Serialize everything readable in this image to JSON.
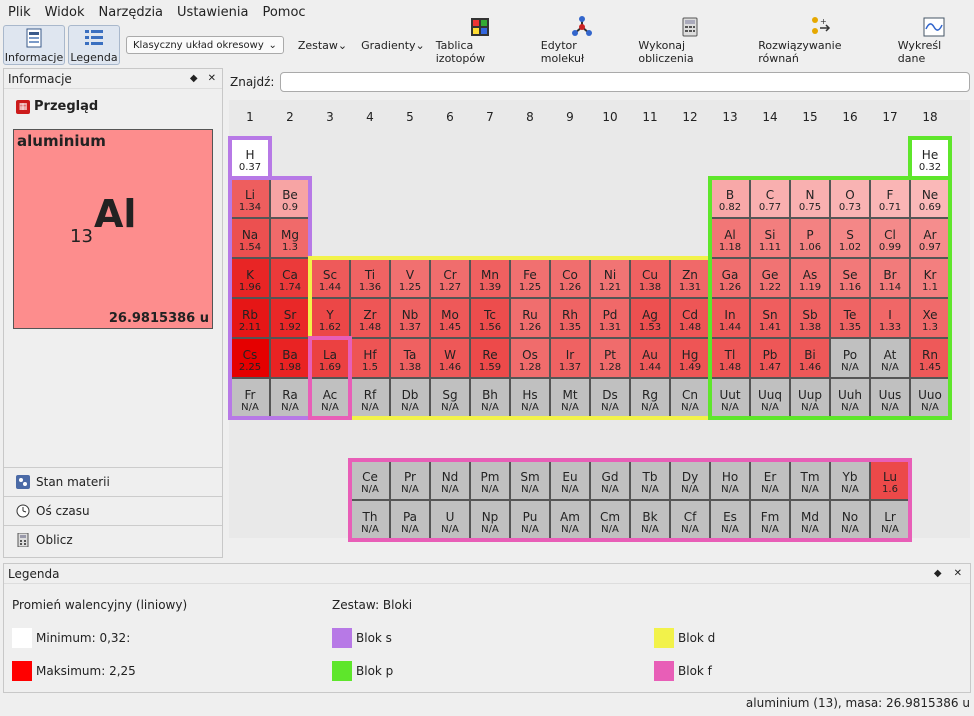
{
  "menu": [
    "Plik",
    "Widok",
    "Narzędzia",
    "Ustawienia",
    "Pomoc"
  ],
  "toolbar": {
    "info": "Informacje",
    "legend": "Legenda",
    "layout": "Klasyczny układ okresowy",
    "sets": "Zestaw",
    "gradients": "Gradienty",
    "isotopes": "Tablica izotopów",
    "molecule": "Edytor molekuł",
    "calc": "Wykonaj obliczenia",
    "equations": "Rozwiązywanie równań",
    "plot": "Wykreśl dane"
  },
  "info_panel": {
    "title": "Informacje",
    "overview": "Przegląd",
    "element_name": "aluminium",
    "element_symbol": "Al",
    "element_number": "13",
    "element_mass": "26.9815386 u"
  },
  "side_tabs": [
    "Stan materii",
    "Oś czasu",
    "Oblicz"
  ],
  "find": {
    "label": "Znajdź:",
    "value": ""
  },
  "groups": [
    "1",
    "2",
    "3",
    "4",
    "5",
    "6",
    "7",
    "8",
    "9",
    "10",
    "11",
    "12",
    "13",
    "14",
    "15",
    "16",
    "17",
    "18"
  ],
  "elements": [
    {
      "s": "H",
      "v": "0.37",
      "g": 1,
      "p": 1,
      "c": "#ffffff"
    },
    {
      "s": "He",
      "v": "0.32",
      "g": 18,
      "p": 1,
      "c": "#ffffff"
    },
    {
      "s": "Li",
      "v": "1.34",
      "g": 1,
      "p": 2,
      "c": "#ee5e5e"
    },
    {
      "s": "Be",
      "v": "0.9",
      "g": 2,
      "p": 2,
      "c": "#f7a4a4"
    },
    {
      "s": "B",
      "v": "0.82",
      "g": 13,
      "p": 2,
      "c": "#f8a8a8"
    },
    {
      "s": "C",
      "v": "0.77",
      "g": 14,
      "p": 2,
      "c": "#f9afaf"
    },
    {
      "s": "N",
      "v": "0.75",
      "g": 15,
      "p": 2,
      "c": "#f9b0b0"
    },
    {
      "s": "O",
      "v": "0.73",
      "g": 16,
      "p": 2,
      "c": "#f9b3b3"
    },
    {
      "s": "F",
      "v": "0.71",
      "g": 17,
      "p": 2,
      "c": "#fab5b5"
    },
    {
      "s": "Ne",
      "v": "0.69",
      "g": 18,
      "p": 2,
      "c": "#fab8b8"
    },
    {
      "s": "Na",
      "v": "1.54",
      "g": 1,
      "p": 3,
      "c": "#ec5050"
    },
    {
      "s": "Mg",
      "v": "1.3",
      "g": 2,
      "p": 3,
      "c": "#f06a6a"
    },
    {
      "s": "Al",
      "v": "1.18",
      "g": 13,
      "p": 3,
      "c": "#f27676"
    },
    {
      "s": "Si",
      "v": "1.11",
      "g": 14,
      "p": 3,
      "c": "#f37e7e"
    },
    {
      "s": "P",
      "v": "1.06",
      "g": 15,
      "p": 3,
      "c": "#f38282"
    },
    {
      "s": "S",
      "v": "1.02",
      "g": 16,
      "p": 3,
      "c": "#f48787"
    },
    {
      "s": "Cl",
      "v": "0.99",
      "g": 17,
      "p": 3,
      "c": "#f48a8a"
    },
    {
      "s": "Ar",
      "v": "0.97",
      "g": 18,
      "p": 3,
      "c": "#f58d8d"
    },
    {
      "s": "K",
      "v": "1.96",
      "g": 1,
      "p": 4,
      "c": "#e82525"
    },
    {
      "s": "Ca",
      "v": "1.74",
      "g": 2,
      "p": 4,
      "c": "#eb3a3a"
    },
    {
      "s": "Sc",
      "v": "1.44",
      "g": 3,
      "p": 4,
      "c": "#ee5a5a"
    },
    {
      "s": "Ti",
      "v": "1.36",
      "g": 4,
      "p": 4,
      "c": "#ef6363"
    },
    {
      "s": "V",
      "v": "1.25",
      "g": 5,
      "p": 4,
      "c": "#f17070"
    },
    {
      "s": "Cr",
      "v": "1.27",
      "g": 6,
      "p": 4,
      "c": "#f06d6d"
    },
    {
      "s": "Mn",
      "v": "1.39",
      "g": 7,
      "p": 4,
      "c": "#ef6060"
    },
    {
      "s": "Fe",
      "v": "1.25",
      "g": 8,
      "p": 4,
      "c": "#f17070"
    },
    {
      "s": "Co",
      "v": "1.26",
      "g": 9,
      "p": 4,
      "c": "#f06e6e"
    },
    {
      "s": "Ni",
      "v": "1.21",
      "g": 10,
      "p": 4,
      "c": "#f17474"
    },
    {
      "s": "Cu",
      "v": "1.38",
      "g": 11,
      "p": 4,
      "c": "#ef6161"
    },
    {
      "s": "Zn",
      "v": "1.31",
      "g": 12,
      "p": 4,
      "c": "#f06969"
    },
    {
      "s": "Ga",
      "v": "1.26",
      "g": 13,
      "p": 4,
      "c": "#f06e6e"
    },
    {
      "s": "Ge",
      "v": "1.22",
      "g": 14,
      "p": 4,
      "c": "#f17373"
    },
    {
      "s": "As",
      "v": "1.19",
      "g": 15,
      "p": 4,
      "c": "#f27575"
    },
    {
      "s": "Se",
      "v": "1.16",
      "g": 16,
      "p": 4,
      "c": "#f27979"
    },
    {
      "s": "Br",
      "v": "1.14",
      "g": 17,
      "p": 4,
      "c": "#f27b7b"
    },
    {
      "s": "Kr",
      "v": "1.1",
      "g": 18,
      "p": 4,
      "c": "#f37f7f"
    },
    {
      "s": "Rb",
      "v": "2.11",
      "g": 1,
      "p": 5,
      "c": "#e61616"
    },
    {
      "s": "Sr",
      "v": "1.92",
      "g": 2,
      "p": 5,
      "c": "#e92828"
    },
    {
      "s": "Y",
      "v": "1.62",
      "g": 3,
      "p": 5,
      "c": "#ec4747"
    },
    {
      "s": "Zr",
      "v": "1.48",
      "g": 4,
      "p": 5,
      "c": "#ee5656"
    },
    {
      "s": "Nb",
      "v": "1.37",
      "g": 5,
      "p": 5,
      "c": "#ef6262"
    },
    {
      "s": "Mo",
      "v": "1.45",
      "g": 6,
      "p": 5,
      "c": "#ee5959"
    },
    {
      "s": "Tc",
      "v": "1.56",
      "g": 7,
      "p": 5,
      "c": "#ed4d4d"
    },
    {
      "s": "Ru",
      "v": "1.26",
      "g": 8,
      "p": 5,
      "c": "#f06e6e"
    },
    {
      "s": "Rh",
      "v": "1.35",
      "g": 9,
      "p": 5,
      "c": "#ef6464"
    },
    {
      "s": "Pd",
      "v": "1.31",
      "g": 10,
      "p": 5,
      "c": "#f06969"
    },
    {
      "s": "Ag",
      "v": "1.53",
      "g": 11,
      "p": 5,
      "c": "#ed5050"
    },
    {
      "s": "Cd",
      "v": "1.48",
      "g": 12,
      "p": 5,
      "c": "#ee5656"
    },
    {
      "s": "In",
      "v": "1.44",
      "g": 13,
      "p": 5,
      "c": "#ee5a5a"
    },
    {
      "s": "Sn",
      "v": "1.41",
      "g": 14,
      "p": 5,
      "c": "#ef5e5e"
    },
    {
      "s": "Sb",
      "v": "1.38",
      "g": 15,
      "p": 5,
      "c": "#ef6161"
    },
    {
      "s": "Te",
      "v": "1.35",
      "g": 16,
      "p": 5,
      "c": "#ef6464"
    },
    {
      "s": "I",
      "v": "1.33",
      "g": 17,
      "p": 5,
      "c": "#f06767"
    },
    {
      "s": "Xe",
      "v": "1.3",
      "g": 18,
      "p": 5,
      "c": "#f06a6a"
    },
    {
      "s": "Cs",
      "v": "2.25",
      "g": 1,
      "p": 6,
      "c": "#e50000"
    },
    {
      "s": "Ba",
      "v": "1.98",
      "g": 2,
      "p": 6,
      "c": "#e92323"
    },
    {
      "s": "La",
      "v": "1.69",
      "g": 3,
      "p": 6,
      "c": "#eb4141"
    },
    {
      "s": "Hf",
      "v": "1.5",
      "g": 4,
      "p": 6,
      "c": "#ee5454"
    },
    {
      "s": "Ta",
      "v": "1.38",
      "g": 5,
      "p": 6,
      "c": "#ef6161"
    },
    {
      "s": "W",
      "v": "1.46",
      "g": 6,
      "p": 6,
      "c": "#ee5858"
    },
    {
      "s": "Re",
      "v": "1.59",
      "g": 7,
      "p": 6,
      "c": "#ed4a4a"
    },
    {
      "s": "Os",
      "v": "1.28",
      "g": 8,
      "p": 6,
      "c": "#f06c6c"
    },
    {
      "s": "Ir",
      "v": "1.37",
      "g": 9,
      "p": 6,
      "c": "#ef6262"
    },
    {
      "s": "Pt",
      "v": "1.28",
      "g": 10,
      "p": 6,
      "c": "#f06c6c"
    },
    {
      "s": "Au",
      "v": "1.44",
      "g": 11,
      "p": 6,
      "c": "#ee5a5a"
    },
    {
      "s": "Hg",
      "v": "1.49",
      "g": 12,
      "p": 6,
      "c": "#ee5555"
    },
    {
      "s": "Tl",
      "v": "1.48",
      "g": 13,
      "p": 6,
      "c": "#ee5656"
    },
    {
      "s": "Pb",
      "v": "1.47",
      "g": 14,
      "p": 6,
      "c": "#ee5757"
    },
    {
      "s": "Bi",
      "v": "1.46",
      "g": 15,
      "p": 6,
      "c": "#ee5858"
    },
    {
      "s": "Po",
      "v": "N/A",
      "g": 16,
      "p": 6,
      "c": "#c0c0c0"
    },
    {
      "s": "At",
      "v": "N/A",
      "g": 17,
      "p": 6,
      "c": "#c0c0c0"
    },
    {
      "s": "Rn",
      "v": "1.45",
      "g": 18,
      "p": 6,
      "c": "#ee5959"
    },
    {
      "s": "Fr",
      "v": "N/A",
      "g": 1,
      "p": 7,
      "c": "#c0c0c0"
    },
    {
      "s": "Ra",
      "v": "N/A",
      "g": 2,
      "p": 7,
      "c": "#c0c0c0"
    },
    {
      "s": "Ac",
      "v": "N/A",
      "g": 3,
      "p": 7,
      "c": "#c0c0c0"
    },
    {
      "s": "Rf",
      "v": "N/A",
      "g": 4,
      "p": 7,
      "c": "#c0c0c0"
    },
    {
      "s": "Db",
      "v": "N/A",
      "g": 5,
      "p": 7,
      "c": "#c0c0c0"
    },
    {
      "s": "Sg",
      "v": "N/A",
      "g": 6,
      "p": 7,
      "c": "#c0c0c0"
    },
    {
      "s": "Bh",
      "v": "N/A",
      "g": 7,
      "p": 7,
      "c": "#c0c0c0"
    },
    {
      "s": "Hs",
      "v": "N/A",
      "g": 8,
      "p": 7,
      "c": "#c0c0c0"
    },
    {
      "s": "Mt",
      "v": "N/A",
      "g": 9,
      "p": 7,
      "c": "#c0c0c0"
    },
    {
      "s": "Ds",
      "v": "N/A",
      "g": 10,
      "p": 7,
      "c": "#c0c0c0"
    },
    {
      "s": "Rg",
      "v": "N/A",
      "g": 11,
      "p": 7,
      "c": "#c0c0c0"
    },
    {
      "s": "Cn",
      "v": "N/A",
      "g": 12,
      "p": 7,
      "c": "#c0c0c0"
    },
    {
      "s": "Uut",
      "v": "N/A",
      "g": 13,
      "p": 7,
      "c": "#c0c0c0"
    },
    {
      "s": "Uuq",
      "v": "N/A",
      "g": 14,
      "p": 7,
      "c": "#c0c0c0"
    },
    {
      "s": "Uup",
      "v": "N/A",
      "g": 15,
      "p": 7,
      "c": "#c0c0c0"
    },
    {
      "s": "Uuh",
      "v": "N/A",
      "g": 16,
      "p": 7,
      "c": "#c0c0c0"
    },
    {
      "s": "Uus",
      "v": "N/A",
      "g": 17,
      "p": 7,
      "c": "#c0c0c0"
    },
    {
      "s": "Uuo",
      "v": "N/A",
      "g": 18,
      "p": 7,
      "c": "#c0c0c0"
    }
  ],
  "f_rows": [
    [
      {
        "s": "Ce",
        "v": "N/A"
      },
      {
        "s": "Pr",
        "v": "N/A"
      },
      {
        "s": "Nd",
        "v": "N/A"
      },
      {
        "s": "Pm",
        "v": "N/A"
      },
      {
        "s": "Sm",
        "v": "N/A"
      },
      {
        "s": "Eu",
        "v": "N/A"
      },
      {
        "s": "Gd",
        "v": "N/A"
      },
      {
        "s": "Tb",
        "v": "N/A"
      },
      {
        "s": "Dy",
        "v": "N/A"
      },
      {
        "s": "Ho",
        "v": "N/A"
      },
      {
        "s": "Er",
        "v": "N/A"
      },
      {
        "s": "Tm",
        "v": "N/A"
      },
      {
        "s": "Yb",
        "v": "N/A"
      },
      {
        "s": "Lu",
        "v": "1.6",
        "c": "#ec4949"
      }
    ],
    [
      {
        "s": "Th",
        "v": "N/A"
      },
      {
        "s": "Pa",
        "v": "N/A"
      },
      {
        "s": "U",
        "v": "N/A"
      },
      {
        "s": "Np",
        "v": "N/A"
      },
      {
        "s": "Pu",
        "v": "N/A"
      },
      {
        "s": "Am",
        "v": "N/A"
      },
      {
        "s": "Cm",
        "v": "N/A"
      },
      {
        "s": "Bk",
        "v": "N/A"
      },
      {
        "s": "Cf",
        "v": "N/A"
      },
      {
        "s": "Es",
        "v": "N/A"
      },
      {
        "s": "Fm",
        "v": "N/A"
      },
      {
        "s": "Md",
        "v": "N/A"
      },
      {
        "s": "No",
        "v": "N/A"
      },
      {
        "s": "Lr",
        "v": "N/A"
      }
    ]
  ],
  "colors": {
    "s_block": "#b779e6",
    "d_block": "#f2f24a",
    "p_block": "#5ee62b",
    "f_block": "#e85eb7",
    "na": "#c0c0c0",
    "min": "#ffffff",
    "max": "#ff0000"
  },
  "legend": {
    "title": "Legenda",
    "gradient_title": "Promień walencyjny (liniowy)",
    "min": "Minimum: 0,32:",
    "max": "Maksimum: 2,25",
    "set_title": "Zestaw: Bloki",
    "s": "Blok s",
    "p": "Blok p",
    "d": "Blok d",
    "f": "Blok f"
  },
  "status": "aluminium (13), masa: 26.9815386 u"
}
